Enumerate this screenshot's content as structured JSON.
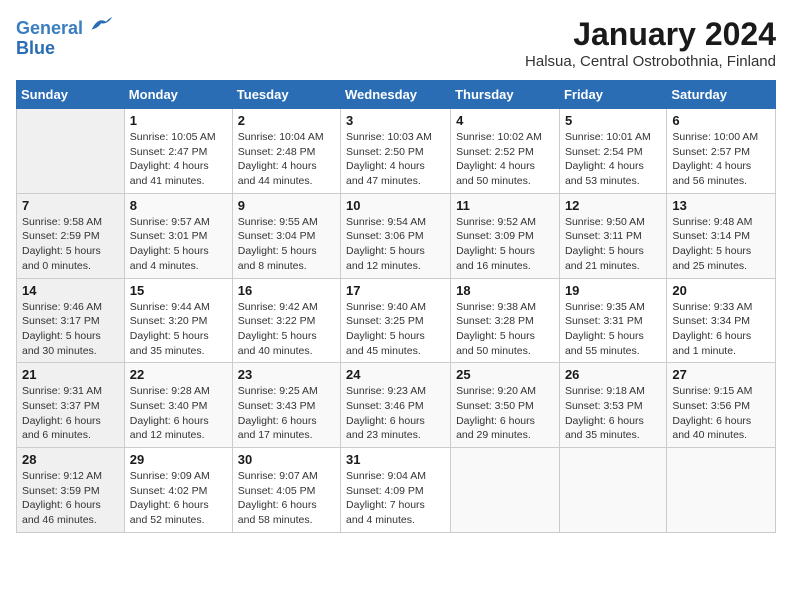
{
  "header": {
    "logo_line1": "General",
    "logo_line2": "Blue",
    "month": "January 2024",
    "location": "Halsua, Central Ostrobothnia, Finland"
  },
  "weekdays": [
    "Sunday",
    "Monday",
    "Tuesday",
    "Wednesday",
    "Thursday",
    "Friday",
    "Saturday"
  ],
  "weeks": [
    [
      {
        "day": "",
        "info": ""
      },
      {
        "day": "1",
        "info": "Sunrise: 10:05 AM\nSunset: 2:47 PM\nDaylight: 4 hours\nand 41 minutes."
      },
      {
        "day": "2",
        "info": "Sunrise: 10:04 AM\nSunset: 2:48 PM\nDaylight: 4 hours\nand 44 minutes."
      },
      {
        "day": "3",
        "info": "Sunrise: 10:03 AM\nSunset: 2:50 PM\nDaylight: 4 hours\nand 47 minutes."
      },
      {
        "day": "4",
        "info": "Sunrise: 10:02 AM\nSunset: 2:52 PM\nDaylight: 4 hours\nand 50 minutes."
      },
      {
        "day": "5",
        "info": "Sunrise: 10:01 AM\nSunset: 2:54 PM\nDaylight: 4 hours\nand 53 minutes."
      },
      {
        "day": "6",
        "info": "Sunrise: 10:00 AM\nSunset: 2:57 PM\nDaylight: 4 hours\nand 56 minutes."
      }
    ],
    [
      {
        "day": "7",
        "info": "Sunrise: 9:58 AM\nSunset: 2:59 PM\nDaylight: 5 hours\nand 0 minutes."
      },
      {
        "day": "8",
        "info": "Sunrise: 9:57 AM\nSunset: 3:01 PM\nDaylight: 5 hours\nand 4 minutes."
      },
      {
        "day": "9",
        "info": "Sunrise: 9:55 AM\nSunset: 3:04 PM\nDaylight: 5 hours\nand 8 minutes."
      },
      {
        "day": "10",
        "info": "Sunrise: 9:54 AM\nSunset: 3:06 PM\nDaylight: 5 hours\nand 12 minutes."
      },
      {
        "day": "11",
        "info": "Sunrise: 9:52 AM\nSunset: 3:09 PM\nDaylight: 5 hours\nand 16 minutes."
      },
      {
        "day": "12",
        "info": "Sunrise: 9:50 AM\nSunset: 3:11 PM\nDaylight: 5 hours\nand 21 minutes."
      },
      {
        "day": "13",
        "info": "Sunrise: 9:48 AM\nSunset: 3:14 PM\nDaylight: 5 hours\nand 25 minutes."
      }
    ],
    [
      {
        "day": "14",
        "info": "Sunrise: 9:46 AM\nSunset: 3:17 PM\nDaylight: 5 hours\nand 30 minutes."
      },
      {
        "day": "15",
        "info": "Sunrise: 9:44 AM\nSunset: 3:20 PM\nDaylight: 5 hours\nand 35 minutes."
      },
      {
        "day": "16",
        "info": "Sunrise: 9:42 AM\nSunset: 3:22 PM\nDaylight: 5 hours\nand 40 minutes."
      },
      {
        "day": "17",
        "info": "Sunrise: 9:40 AM\nSunset: 3:25 PM\nDaylight: 5 hours\nand 45 minutes."
      },
      {
        "day": "18",
        "info": "Sunrise: 9:38 AM\nSunset: 3:28 PM\nDaylight: 5 hours\nand 50 minutes."
      },
      {
        "day": "19",
        "info": "Sunrise: 9:35 AM\nSunset: 3:31 PM\nDaylight: 5 hours\nand 55 minutes."
      },
      {
        "day": "20",
        "info": "Sunrise: 9:33 AM\nSunset: 3:34 PM\nDaylight: 6 hours\nand 1 minute."
      }
    ],
    [
      {
        "day": "21",
        "info": "Sunrise: 9:31 AM\nSunset: 3:37 PM\nDaylight: 6 hours\nand 6 minutes."
      },
      {
        "day": "22",
        "info": "Sunrise: 9:28 AM\nSunset: 3:40 PM\nDaylight: 6 hours\nand 12 minutes."
      },
      {
        "day": "23",
        "info": "Sunrise: 9:25 AM\nSunset: 3:43 PM\nDaylight: 6 hours\nand 17 minutes."
      },
      {
        "day": "24",
        "info": "Sunrise: 9:23 AM\nSunset: 3:46 PM\nDaylight: 6 hours\nand 23 minutes."
      },
      {
        "day": "25",
        "info": "Sunrise: 9:20 AM\nSunset: 3:50 PM\nDaylight: 6 hours\nand 29 minutes."
      },
      {
        "day": "26",
        "info": "Sunrise: 9:18 AM\nSunset: 3:53 PM\nDaylight: 6 hours\nand 35 minutes."
      },
      {
        "day": "27",
        "info": "Sunrise: 9:15 AM\nSunset: 3:56 PM\nDaylight: 6 hours\nand 40 minutes."
      }
    ],
    [
      {
        "day": "28",
        "info": "Sunrise: 9:12 AM\nSunset: 3:59 PM\nDaylight: 6 hours\nand 46 minutes."
      },
      {
        "day": "29",
        "info": "Sunrise: 9:09 AM\nSunset: 4:02 PM\nDaylight: 6 hours\nand 52 minutes."
      },
      {
        "day": "30",
        "info": "Sunrise: 9:07 AM\nSunset: 4:05 PM\nDaylight: 6 hours\nand 58 minutes."
      },
      {
        "day": "31",
        "info": "Sunrise: 9:04 AM\nSunset: 4:09 PM\nDaylight: 7 hours\nand 4 minutes."
      },
      {
        "day": "",
        "info": ""
      },
      {
        "day": "",
        "info": ""
      },
      {
        "day": "",
        "info": ""
      }
    ]
  ]
}
